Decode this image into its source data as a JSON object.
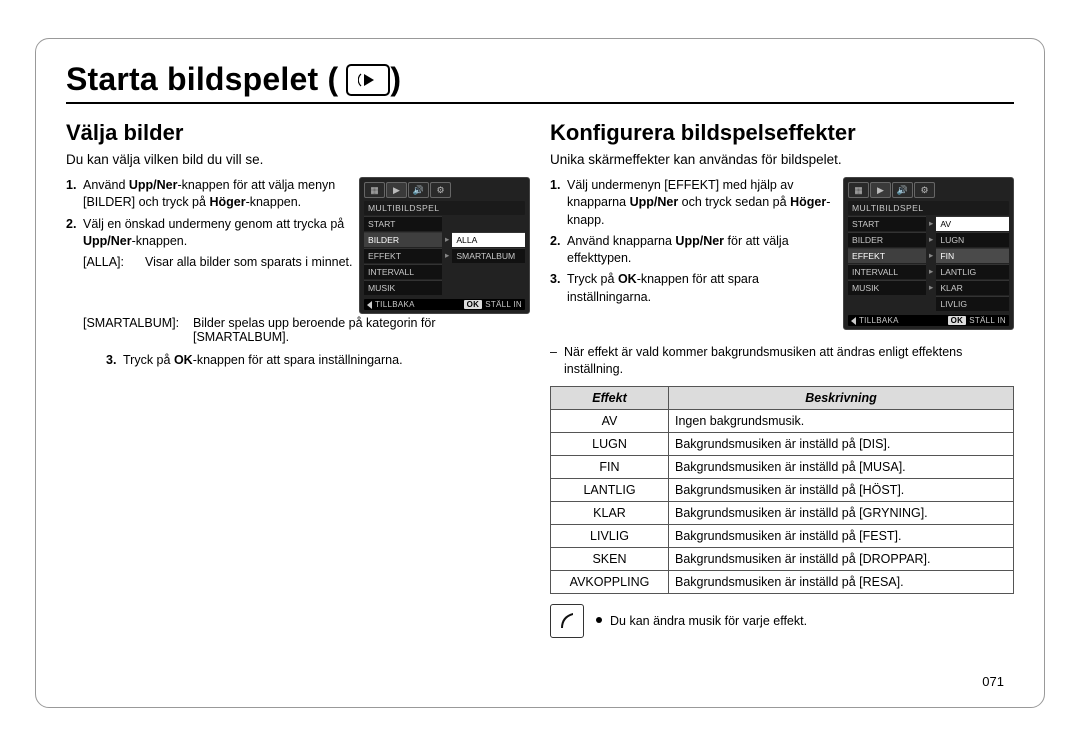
{
  "page_number": "071",
  "title": "Starta bildspelet (",
  "title_suffix": " )",
  "left": {
    "heading": "Välja bilder",
    "intro": "Du kan välja vilken bild du vill se.",
    "steps": {
      "s1": {
        "n": "1.",
        "pre": "Använd ",
        "b1": "Upp/Ner",
        "mid1": "-knappen för att välja menyn [BILDER] och tryck på ",
        "b2": "Höger",
        "mid2": "-knappen."
      },
      "s2": {
        "n": "2.",
        "pre": "Välj en önskad undermeny genom att trycka på ",
        "b1": "Upp/Ner",
        "post": "-knappen."
      },
      "kv1": {
        "k": "[ALLA]:",
        "v": "Visar alla bilder som sparats i minnet."
      },
      "kv2": {
        "k": "[SMARTALBUM]:",
        "v": "Bilder spelas upp beroende på kategorin för [SMARTALBUM]."
      },
      "s3": {
        "n": "3.",
        "pre": "Tryck på ",
        "b1": "OK",
        "post": "-knappen för att spara inställningarna."
      }
    },
    "lcd": {
      "title": "MULTIBILDSPEL",
      "rows": [
        "START",
        "BILDER",
        "EFFEKT",
        "INTERVALL",
        "MUSIK"
      ],
      "active_index": 1,
      "subs": {
        "1": [
          "ALLA",
          "SMARTALBUM"
        ],
        "sel": "ALLA"
      },
      "back": "TILLBAKA",
      "set": "STÄLL IN",
      "ok": "OK"
    }
  },
  "right": {
    "heading": "Konfigurera bildspelseffekter",
    "intro": "Unika skärmeffekter kan användas för bildspelet.",
    "steps": {
      "s1": {
        "n": "1.",
        "pre": "Välj undermenyn [EFFEKT] med hjälp av knapparna ",
        "b1": "Upp/Ner",
        "mid1": " och tryck sedan på ",
        "b2": "Höger",
        "mid2": "-knapp."
      },
      "s2": {
        "n": "2.",
        "pre": "Använd knapparna ",
        "b1": "Upp/Ner",
        "post": " för att välja effekttypen."
      },
      "s3": {
        "n": "3.",
        "pre": "Tryck på ",
        "b1": "OK",
        "post": "-knappen för att spara inställningarna."
      }
    },
    "note": "När effekt är vald kommer bakgrundsmusiken att ändras enligt effektens inställning.",
    "lcd": {
      "title": "MULTIBILDSPEL",
      "rows": [
        "START",
        "BILDER",
        "EFFEKT",
        "INTERVALL",
        "MUSIK"
      ],
      "active_index": 2,
      "subs": [
        "AV",
        "LUGN",
        "FIN",
        "LANTLIG",
        "KLAR",
        "LIVLIG"
      ],
      "sel": "AV",
      "back": "TILLBAKA",
      "set": "STÄLL IN",
      "ok": "OK"
    },
    "table": {
      "head": {
        "eff": "Effekt",
        "desc": "Beskrivning"
      },
      "rows": [
        {
          "eff": "AV",
          "desc": "Ingen bakgrundsmusik."
        },
        {
          "eff": "LUGN",
          "desc": "Bakgrundsmusiken är inställd på [DIS]."
        },
        {
          "eff": "FIN",
          "desc": "Bakgrundsmusiken är inställd på [MUSA]."
        },
        {
          "eff": "LANTLIG",
          "desc": "Bakgrundsmusiken är inställd på [HÖST]."
        },
        {
          "eff": "KLAR",
          "desc": "Bakgrundsmusiken är inställd på [GRYNING]."
        },
        {
          "eff": "LIVLIG",
          "desc": "Bakgrundsmusiken är inställd på [FEST]."
        },
        {
          "eff": "SKEN",
          "desc": "Bakgrundsmusiken är inställd på [DROPPAR]."
        },
        {
          "eff": "AVKOPPLING",
          "desc": "Bakgrundsmusiken är inställd på [RESA]."
        }
      ]
    },
    "tip": "Du kan ändra musik för varje effekt."
  }
}
